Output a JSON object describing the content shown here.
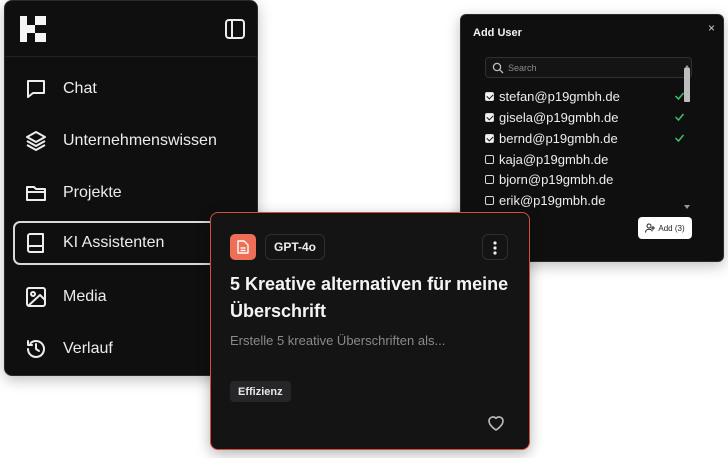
{
  "sidebar": {
    "logo_icon": "brand-logo-icon",
    "toggle_icon": "sidebar-toggle-icon",
    "items": [
      {
        "label": "Chat",
        "icon": "chat-bubble-icon",
        "active": false
      },
      {
        "label": "Unternehmenswissen",
        "icon": "layers-icon",
        "active": false
      },
      {
        "label": "Projekte",
        "icon": "folder-icon",
        "active": false
      },
      {
        "label": "KI Assistenten",
        "icon": "book-icon",
        "active": true
      },
      {
        "label": "Media",
        "icon": "image-icon",
        "active": false
      },
      {
        "label": "Verlauf",
        "icon": "history-icon",
        "active": false
      }
    ]
  },
  "add_user": {
    "title": "Add User",
    "close_label": "×",
    "search_placeholder": "Search",
    "users": [
      {
        "email": "stefan@p19gmbh.de",
        "checked": true,
        "confirmed": true
      },
      {
        "email": "gisela@p19gmbh.de",
        "checked": true,
        "confirmed": true
      },
      {
        "email": "bernd@p19gmbh.de",
        "checked": true,
        "confirmed": true
      },
      {
        "email": "kaja@p19gmbh.de",
        "checked": false,
        "confirmed": false
      },
      {
        "email": "bjorn@p19gmbh.de",
        "checked": false,
        "confirmed": false
      },
      {
        "email": "erik@p19gmbh.de",
        "checked": false,
        "confirmed": false
      }
    ],
    "add_button_label": "Add (3)"
  },
  "card": {
    "model": "GPT-4o",
    "title": "5 Kreative alternativen für meine Überschrift",
    "description": "Erstelle 5 kreative Überschriften als...",
    "tag": "Effizienz"
  },
  "colors": {
    "accent": "#ef6e57",
    "card_border": "#d44e3d",
    "check_green": "#3fbf6a",
    "panel_bg": "#0f0f10"
  }
}
